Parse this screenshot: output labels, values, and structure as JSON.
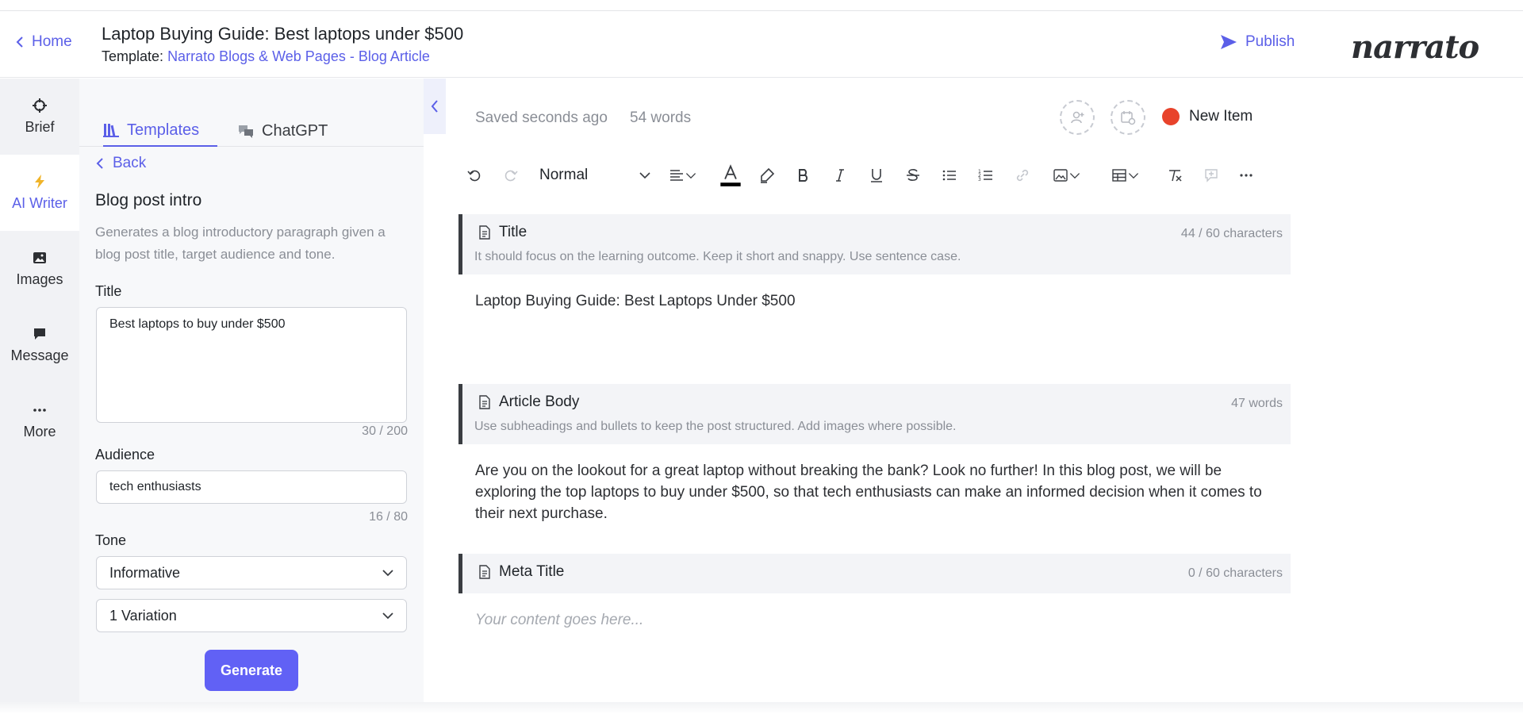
{
  "header": {
    "home_label": "Home",
    "doc_title": "Laptop Buying Guide: Best laptops under $500",
    "template_prefix": "Template:",
    "template_name": "Narrato Blogs & Web Pages - Blog Article",
    "publish_label": "Publish",
    "logo_text": "narrato"
  },
  "rail": {
    "items": [
      {
        "label": "Brief",
        "icon": "target-icon"
      },
      {
        "label": "AI Writer",
        "icon": "bolt-icon"
      },
      {
        "label": "Images",
        "icon": "image-icon"
      },
      {
        "label": "Message",
        "icon": "chat-icon"
      },
      {
        "label": "More",
        "icon": "dots-icon"
      }
    ]
  },
  "panel": {
    "tabs": [
      {
        "label": "Templates",
        "icon": "books-icon"
      },
      {
        "label": "ChatGPT",
        "icon": "chat-bubbles-icon"
      }
    ],
    "back_label": "Back",
    "heading": "Blog post intro",
    "description": "Generates a blog introductory paragraph given a blog post title, target audience and tone.",
    "title_label": "Title",
    "title_value": "Best laptops to buy under $500",
    "title_counter": "30 / 200",
    "audience_label": "Audience",
    "audience_value": "tech enthusiasts",
    "audience_counter": "16 / 80",
    "tone_label": "Tone",
    "tone_value": "Informative",
    "variation_value": "1 Variation",
    "generate_label": "Generate"
  },
  "editor": {
    "saved_status": "Saved seconds ago",
    "word_count": "54 words",
    "new_item_label": "New Item",
    "style_value": "Normal",
    "sections": [
      {
        "title": "Title",
        "hint": "It should focus on the learning outcome. Keep it short and snappy. Use sentence case.",
        "count": "44 / 60 characters",
        "content": "Laptop Buying Guide: Best Laptops Under $500"
      },
      {
        "title": "Article Body",
        "hint": "Use subheadings and bullets to keep the post structured. Add images where possible.",
        "count": "47 words",
        "content": "Are you on the lookout for a great laptop without breaking the bank? Look no further! In this blog post, we will be exploring the top laptops to buy under $500, so that tech enthusiasts can make an informed decision when it comes to their next purchase."
      },
      {
        "title": "Meta Title",
        "hint": "",
        "count": "0 / 60 characters",
        "content": "Your content goes here..."
      }
    ]
  },
  "colors": {
    "accent": "#5b5fe8",
    "generate_button": "#6161f5",
    "new_item_dot": "#e8432b"
  }
}
